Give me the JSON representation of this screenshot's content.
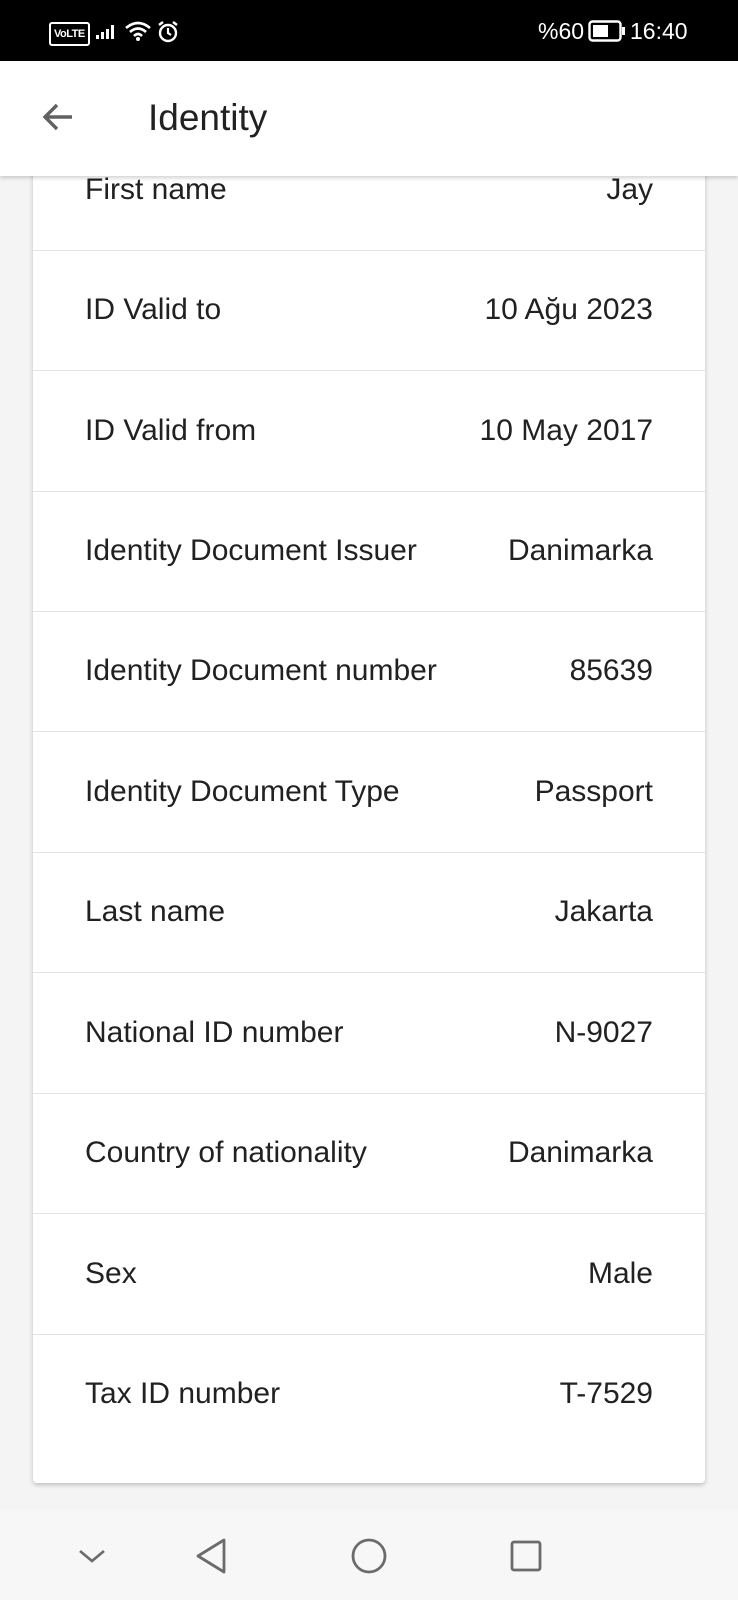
{
  "status_bar": {
    "network_badge": "VoLTE",
    "battery_percent": "%60",
    "time": "16:40",
    "icons": [
      "signal-icon",
      "wifi-icon",
      "alarm-icon",
      "battery-icon"
    ]
  },
  "app_bar": {
    "title": "Identity",
    "back_icon": "arrow-left-icon"
  },
  "rows": [
    {
      "label": "First name",
      "value": "Jay"
    },
    {
      "label": "ID Valid to",
      "value": "10 Ağu 2023"
    },
    {
      "label": "ID Valid from",
      "value": "10 May 2017"
    },
    {
      "label": "Identity Document Issuer",
      "value": "Danimarka"
    },
    {
      "label": "Identity Document number",
      "value": "85639"
    },
    {
      "label": "Identity Document Type",
      "value": "Passport"
    },
    {
      "label": "Last name",
      "value": "Jakarta"
    },
    {
      "label": "National ID number",
      "value": "N-9027"
    },
    {
      "label": "Country of nationality",
      "value": "Danimarka"
    },
    {
      "label": "Sex",
      "value": "Male"
    },
    {
      "label": "Tax ID number",
      "value": "T-7529"
    }
  ],
  "nav_bar": {
    "icons": [
      "chevron-down-icon",
      "back-triangle-icon",
      "home-circle-icon",
      "recents-square-icon"
    ]
  },
  "colors": {
    "status_bar_bg": "#000000",
    "app_bar_bg": "#ffffff",
    "page_bg": "#f4f4f4",
    "text": "#212121",
    "divider": "#e3e3e3"
  }
}
